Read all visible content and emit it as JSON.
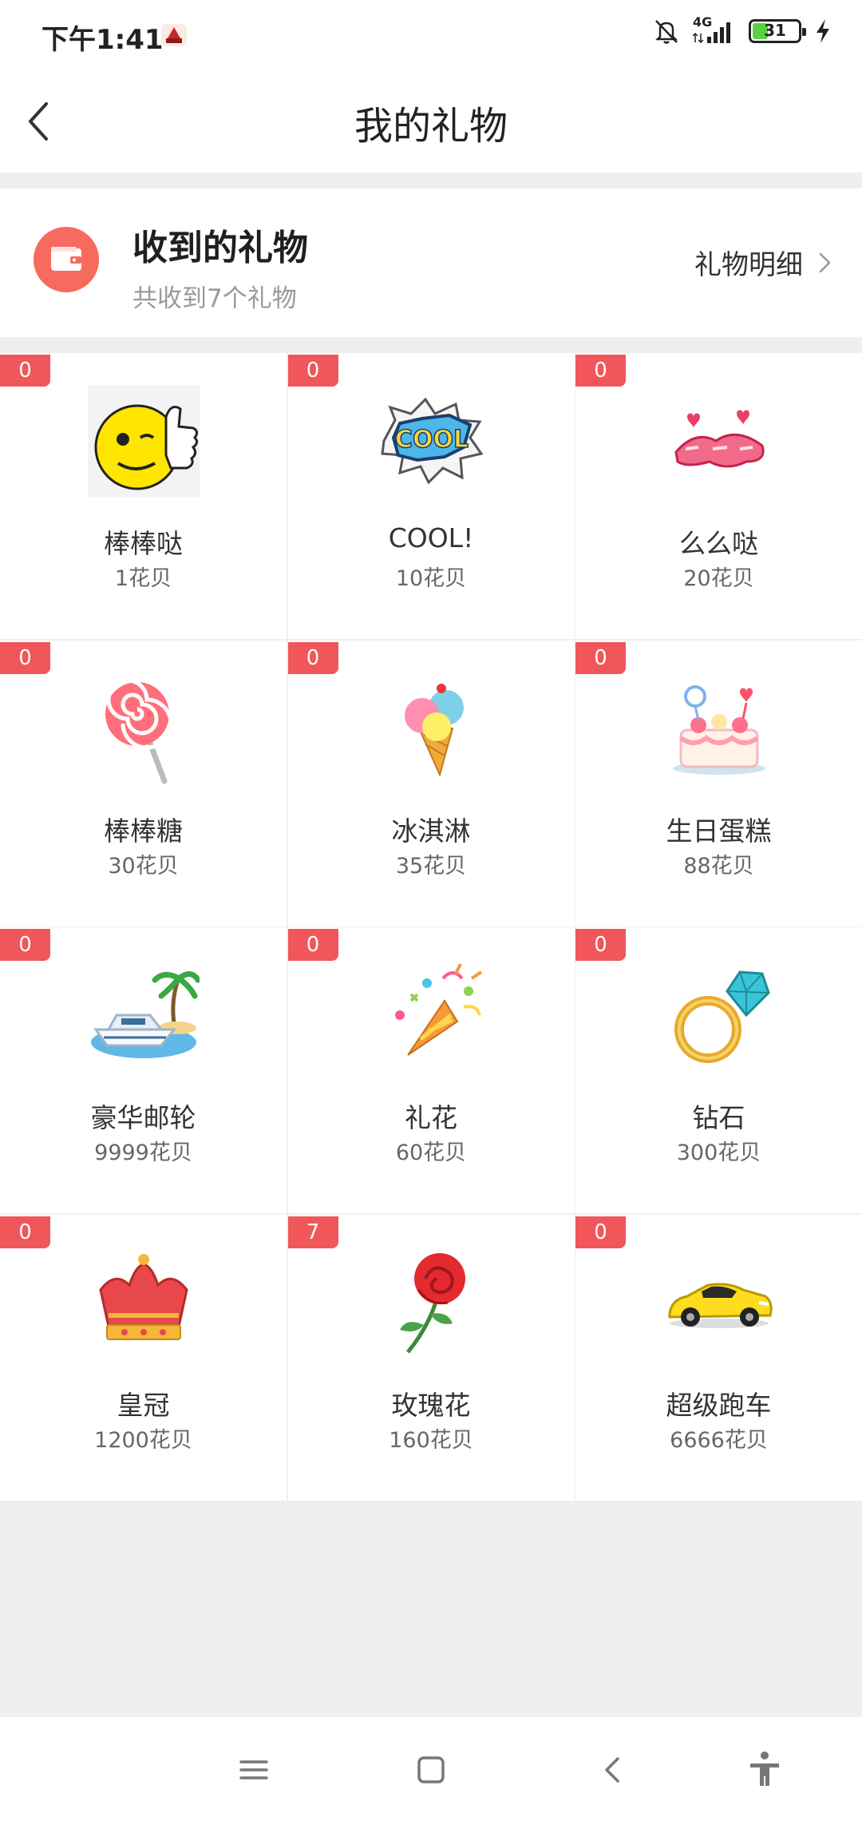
{
  "status": {
    "time": "下午1:41",
    "network": "4G",
    "battery": "31"
  },
  "header": {
    "title": "我的礼物"
  },
  "summary": {
    "title": "收到的礼物",
    "subtitle": "共收到7个礼物",
    "detail_label": "礼物明细"
  },
  "gifts": [
    {
      "name": "棒棒哒",
      "price": "1花贝",
      "count": "0",
      "icon": "thumbs-up-emoji-icon"
    },
    {
      "name": "COOL!",
      "price": "10花贝",
      "count": "0",
      "icon": "cool-sticker-icon"
    },
    {
      "name": "么么哒",
      "price": "20花贝",
      "count": "0",
      "icon": "kiss-text-sticker-icon"
    },
    {
      "name": "棒棒糖",
      "price": "30花贝",
      "count": "0",
      "icon": "lollipop-icon"
    },
    {
      "name": "冰淇淋",
      "price": "35花贝",
      "count": "0",
      "icon": "ice-cream-icon"
    },
    {
      "name": "生日蛋糕",
      "price": "88花贝",
      "count": "0",
      "icon": "birthday-cake-icon"
    },
    {
      "name": "豪华邮轮",
      "price": "9999花贝",
      "count": "0",
      "icon": "yacht-icon"
    },
    {
      "name": "礼花",
      "price": "60花贝",
      "count": "0",
      "icon": "party-popper-icon"
    },
    {
      "name": "钻石",
      "price": "300花贝",
      "count": "0",
      "icon": "diamond-ring-icon"
    },
    {
      "name": "皇冠",
      "price": "1200花贝",
      "count": "0",
      "icon": "crown-icon"
    },
    {
      "name": "玫瑰花",
      "price": "160花贝",
      "count": "7",
      "icon": "rose-icon"
    },
    {
      "name": "超级跑车",
      "price": "6666花贝",
      "count": "0",
      "icon": "sports-car-icon"
    }
  ],
  "colors": {
    "badge": "#f0565a",
    "wallet": "#f76a5e",
    "battery_fill": "#5bd142"
  }
}
